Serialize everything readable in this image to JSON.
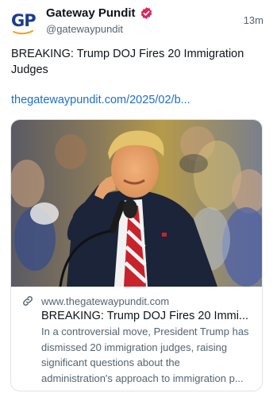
{
  "author": {
    "avatar_text": "GP",
    "display_name": "Gateway Pundit",
    "handle": "@gatewaypundit",
    "verified": true,
    "avatar_icon": "gateway-pundit-logo"
  },
  "timestamp": "13m",
  "post": {
    "text": "BREAKING: Trump DOJ Fires 20 Immigration Judges",
    "link": "thegatewaypundit.com/2025/02/b..."
  },
  "card": {
    "image_icon": "photo-trump-pointing-at-rally",
    "domain": "www.thegatewaypundit.com",
    "title": "BREAKING: Trump DOJ Fires 20 Immi...",
    "description_lines": [
      "In a controversial move, President Trump has",
      "dismissed 20 immigration judges, raising",
      "significant questions about the",
      "administration's approach to immigration p..."
    ]
  },
  "colors": {
    "link": "#1d6fc9",
    "verified": "#e0245e",
    "muted_text": "#536471",
    "brand_navy": "#1d3c8c",
    "brand_orange": "#f39c12"
  }
}
